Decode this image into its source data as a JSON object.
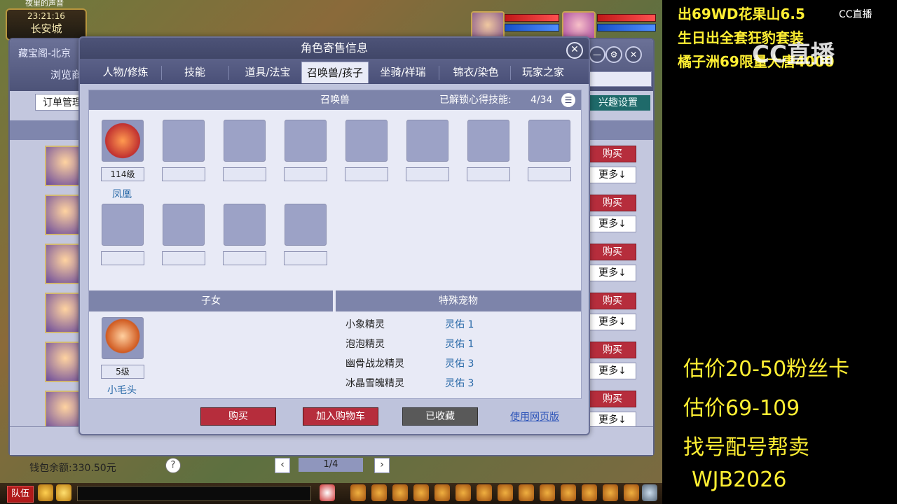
{
  "game": {
    "clock_time": "23:21:16",
    "clock_city": "长安城",
    "top_left_title": "夜里的声音"
  },
  "bg_window": {
    "title": "藏宝阁-北京",
    "browse_label": "浏览商",
    "order_button": "订单管理",
    "interest_button": "兴趣设置",
    "buy_label": "购买",
    "more_label": "更多↓",
    "wallet_label": "钱包余额:330.50元",
    "help_icon": "?",
    "page_prev": "‹",
    "page_next": "›",
    "page_label": "1/4",
    "close_glyph": "✕",
    "settings_glyph": "⚙",
    "min_glyph": "—"
  },
  "modal": {
    "title": "角色寄售信息",
    "close_glyph": "✕",
    "tabs": [
      {
        "label": "人物/修炼"
      },
      {
        "label": "技能"
      },
      {
        "label": "道具/法宝"
      },
      {
        "label": "召唤兽/孩子"
      },
      {
        "label": "坐骑/祥瑞"
      },
      {
        "label": "锦衣/染色"
      },
      {
        "label": "玩家之家"
      }
    ],
    "pets_header": "召唤兽",
    "unlocked_label": "已解锁心得技能:",
    "unlocked_value": "4/34",
    "list_glyph": "☰",
    "pet": {
      "level": "114级",
      "name": "凤凰"
    },
    "children_header": "子女",
    "child": {
      "level": "5级",
      "name": "小毛头"
    },
    "special_header": "特殊宠物",
    "special_pets": [
      {
        "name": "小象精灵",
        "value": "灵佑 1"
      },
      {
        "name": "泡泡精灵",
        "value": "灵佑 1"
      },
      {
        "name": "幽骨战龙精灵",
        "value": "灵佑 3"
      },
      {
        "name": "冰晶雪魄精灵",
        "value": "灵佑 3"
      }
    ],
    "buy_button": "购买",
    "cart_button": "加入购物车",
    "fav_button": "已收藏",
    "web_link": "使用网页版"
  },
  "taskbar": {
    "team_button": "队伍"
  },
  "overlay": {
    "lines": [
      "出69WD花果山6.5",
      "生日出全套狂豹套装",
      "橘子洲69限量大唐4000"
    ],
    "cc_logo_text": "CC直播",
    "cc_watermark": "CC直播",
    "big_lines": [
      "估价20-50粉丝卡",
      "估价69-109",
      "找号配号帮卖",
      "WJB2026"
    ]
  }
}
